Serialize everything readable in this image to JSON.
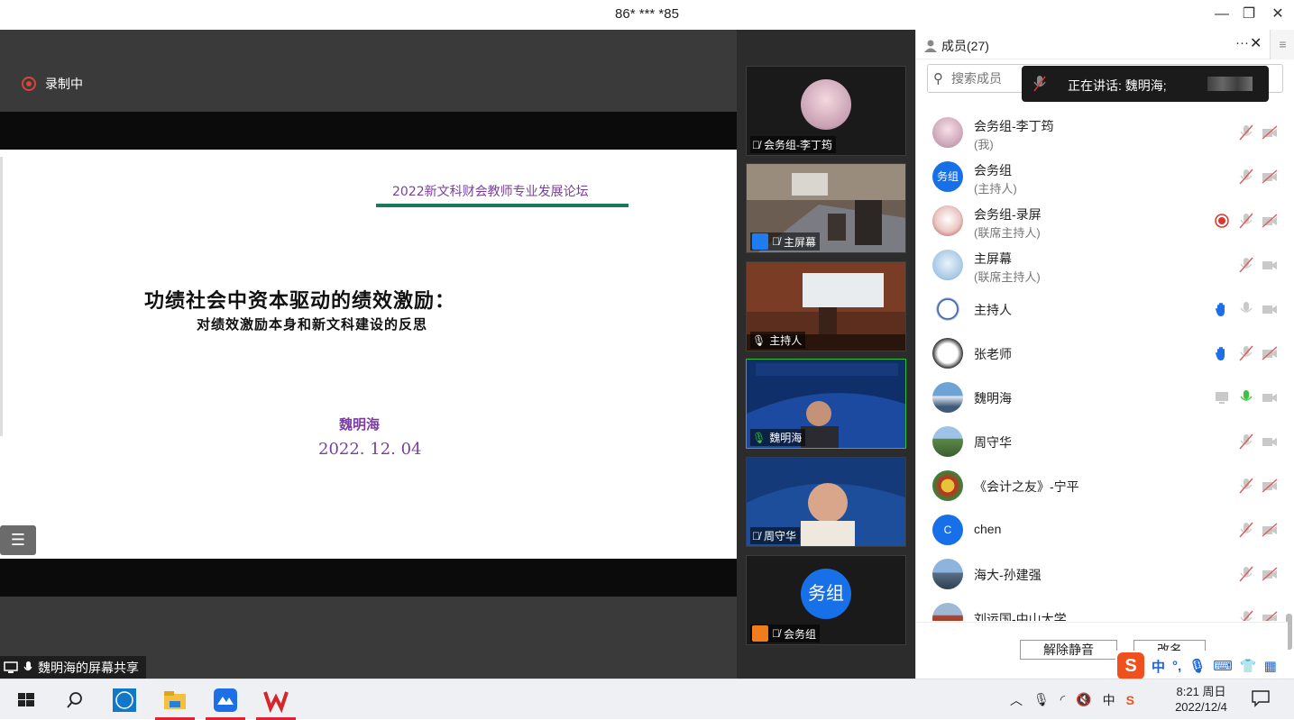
{
  "window": {
    "title": "86* *** *85"
  },
  "stage": {
    "recording_label": "录制中",
    "share_label": "魏明海的屏幕共享",
    "slide": {
      "conference": "2022新文科财会教师专业发展论坛",
      "title": "功绩社会中资本驱动的绩效激励：",
      "subtitle": "对绩效激励本身和新文科建设的反思",
      "author": "魏明海",
      "date": "2022. 12. 04"
    }
  },
  "gallery": [
    {
      "name": "会务组-李丁筠",
      "mic": "muted"
    },
    {
      "name": "主屏幕",
      "mic": "muted"
    },
    {
      "name": "主持人",
      "mic": "on"
    },
    {
      "name": "魏明海",
      "mic": "active"
    },
    {
      "name": "周守华",
      "mic": "muted"
    },
    {
      "name": "会务组",
      "avatar_text": "务组",
      "mic": "muted"
    }
  ],
  "panel": {
    "title": "成员(27)",
    "search_placeholder": "搜索成员",
    "speaking": "正在讲话: 魏明海;",
    "members": [
      {
        "name": "会务组-李丁筠",
        "role": "(我)",
        "avatar": "photo-girl",
        "icons": [
          "mic-muted",
          "cam-off"
        ]
      },
      {
        "name": "会务组",
        "role": "(主持人)",
        "avatar_text": "务组",
        "avatar": "blue",
        "icons": [
          "mic-muted",
          "cam-off"
        ]
      },
      {
        "name": "会务组-录屏",
        "role": "(联席主持人)",
        "avatar": "photo-red",
        "icons": [
          "record",
          "mic-muted",
          "cam-off"
        ]
      },
      {
        "name": "主屏幕",
        "role": "(联席主持人)",
        "avatar": "photo-blue",
        "icons": [
          "mic-muted",
          "cam-on"
        ]
      },
      {
        "name": "主持人",
        "role": "",
        "avatar": "emblem",
        "icons": [
          "hand",
          "mic-on",
          "cam-on"
        ]
      },
      {
        "name": "张老师",
        "role": "",
        "avatar": "panda",
        "icons": [
          "hand",
          "mic-muted",
          "cam-off"
        ]
      },
      {
        "name": "魏明海",
        "role": "",
        "avatar": "mountain",
        "icons": [
          "share",
          "mic-active",
          "cam-on"
        ]
      },
      {
        "name": "周守华",
        "role": "",
        "avatar": "landscape",
        "icons": [
          "mic-muted",
          "cam-on"
        ]
      },
      {
        "name": "《会计之友》-宁平",
        "role": "",
        "avatar": "logo-red",
        "icons": [
          "mic-muted",
          "cam-off"
        ]
      },
      {
        "name": "chen",
        "role": "",
        "avatar_text": "C",
        "avatar": "blue",
        "icons": [
          "mic-muted",
          "cam-off"
        ]
      },
      {
        "name": "海大-孙建强",
        "role": "",
        "avatar": "city",
        "icons": [
          "mic-muted",
          "cam-off"
        ]
      },
      {
        "name": "刘运国-中山大学",
        "role": "",
        "avatar": "building",
        "icons": [
          "mic-muted",
          "cam-off"
        ]
      }
    ],
    "unmute_all": "解除静音",
    "rename": "改名"
  },
  "ime": {
    "mode": "中"
  },
  "taskbar": {
    "time": "8:21 周日",
    "date": "2022/12/4",
    "tray_lang": "中"
  }
}
